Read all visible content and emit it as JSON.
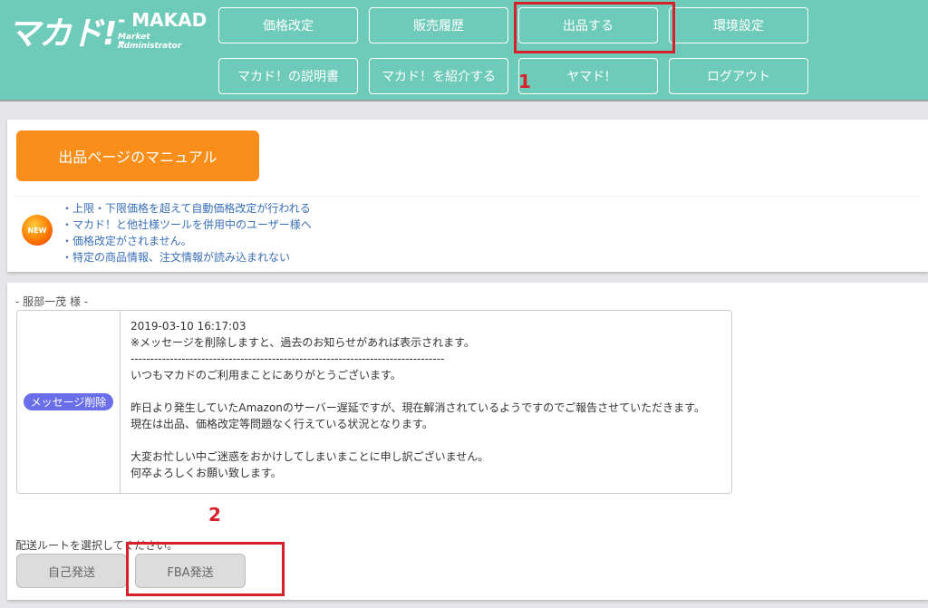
{
  "header": {
    "logo_main": "マカド!",
    "logo_sub": "- MAKAD -",
    "logo_tag": "Market Administrator",
    "nav": [
      {
        "label": "価格改定"
      },
      {
        "label": "販売履歴"
      },
      {
        "label": "出品する"
      },
      {
        "label": "環境設定"
      },
      {
        "label": "マカド！の説明書"
      },
      {
        "label": "マカド！を紹介する"
      },
      {
        "label": "ヤマド!"
      },
      {
        "label": "ログアウト"
      }
    ]
  },
  "annotations": {
    "step1": "1",
    "step2": "2",
    "highlight_color": "#d8202a"
  },
  "manual_button": "出品ページのマニュアル",
  "news": {
    "badge": "NEW",
    "items": [
      "・上限・下限価格を超えて自動価格改定が行われる",
      "・マカド！と他社様ツールを併用中のユーザー様へ",
      "・価格改定がされません。",
      "・特定の商品情報、注文情報が読み込まれない"
    ]
  },
  "user_name": "- 服部一茂 様 -",
  "message": {
    "delete_button": "メッセージ削除",
    "lines": [
      "2019-03-10 16:17:03",
      "※メッセージを削除しますと、過去のお知らせがあれば表示されます。",
      "--------------------------------------------------------------------------------",
      "いつもマカドのご利用まことにありがとうございます。",
      "",
      "昨日より発生していたAmazonのサーバー遅延ですが、現在解消されているようですのでご報告させていただきます。",
      "現在は出品、価格改定等問題なく行えている状況となります。",
      "",
      "大変お忙しい中ご迷惑をおかけしてしまいまことに申し訳ございません。",
      "何卒よろしくお願い致します。"
    ]
  },
  "route": {
    "label": "配送ルートを選択してください。",
    "self_ship": "自己発送",
    "fba": "FBA発送"
  },
  "colors": {
    "header_bg": "#6fcbb9",
    "manual_btn": "#f98e1a",
    "delete_btn": "#6a6ee8",
    "link_text": "#3a6fb8"
  }
}
